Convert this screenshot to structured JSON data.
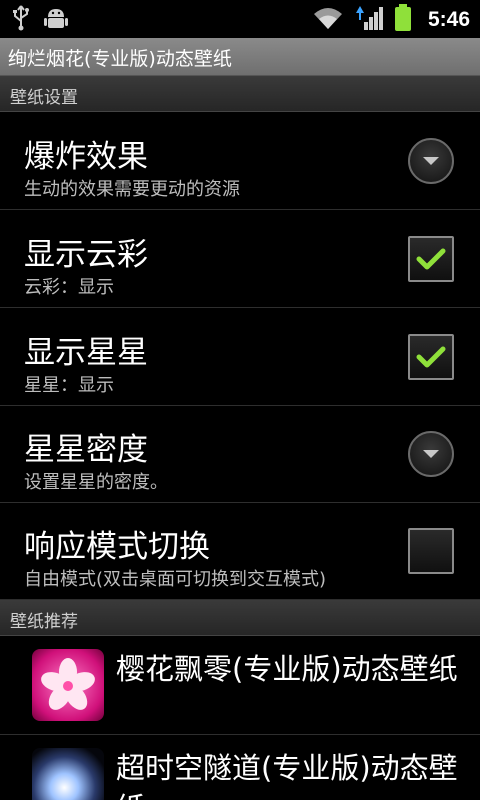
{
  "status_bar": {
    "time": "5:46",
    "icons": [
      "usb-icon",
      "android-debug-icon",
      "wifi-icon",
      "signal-icon",
      "battery-icon"
    ]
  },
  "title_bar": {
    "title": "绚烂烟花(专业版)动态壁纸"
  },
  "settings_section": {
    "header": "壁纸设置",
    "items": [
      {
        "title": "爆炸效果",
        "summary": "生动的效果需要更动的资源",
        "widget": "dropdown"
      },
      {
        "title": "显示云彩",
        "summary": "云彩：显示",
        "widget": "checkbox",
        "checked": true
      },
      {
        "title": "显示星星",
        "summary": "星星：显示",
        "widget": "checkbox",
        "checked": true
      },
      {
        "title": "星星密度",
        "summary": "设置星星的密度。",
        "widget": "dropdown"
      },
      {
        "title": "响应模式切换",
        "summary": "自由模式(双击桌面可切换到交互模式)",
        "widget": "checkbox",
        "checked": false
      }
    ]
  },
  "recommend_section": {
    "header": "壁纸推荐",
    "items": [
      {
        "name": "樱花飘零(专业版)动态壁纸",
        "icon": "sakura-icon"
      },
      {
        "name": "超时空隧道(专业版)动态壁纸",
        "icon": "tunnel-icon"
      }
    ]
  },
  "colors": {
    "accent_check": "#8fe03a",
    "title_bar": "#7d7d7d",
    "category_bar": "#303030"
  }
}
